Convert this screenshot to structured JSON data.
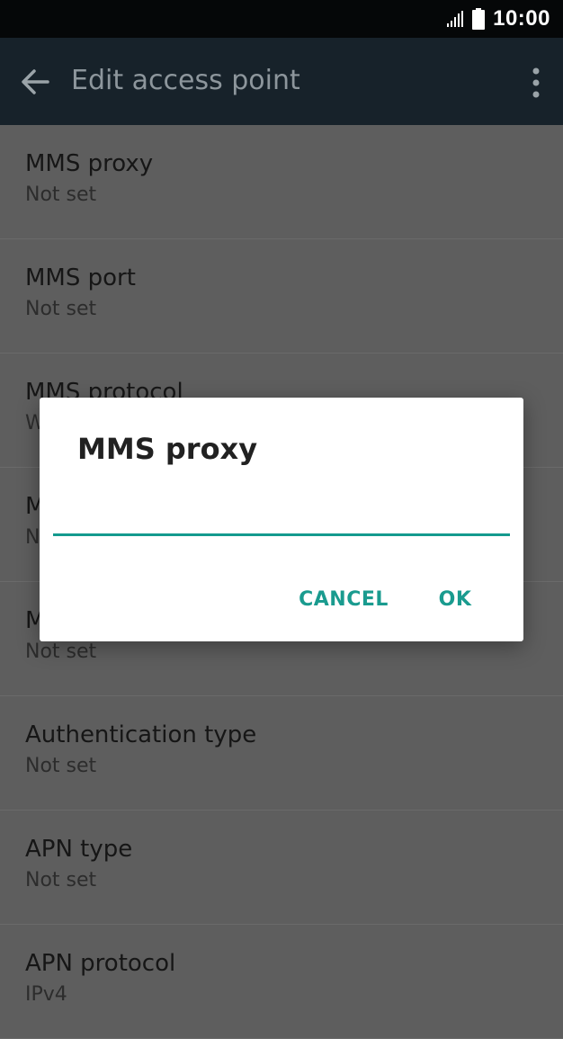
{
  "status_bar": {
    "time": "10:00",
    "icons": [
      "signal-icon",
      "battery-icon"
    ]
  },
  "app_bar": {
    "title": "Edit access point",
    "icons": [
      "back-arrow-icon",
      "more-vert-icon"
    ]
  },
  "list": [
    {
      "title": "MMS proxy",
      "value": "Not set"
    },
    {
      "title": "MMS port",
      "value": "Not set"
    },
    {
      "title": "MMS protocol",
      "value": "W"
    },
    {
      "title": "M",
      "value": "N"
    },
    {
      "title": "M",
      "value": "Not set"
    },
    {
      "title": "Authentication type",
      "value": "Not set"
    },
    {
      "title": "APN type",
      "value": "Not set"
    },
    {
      "title": "APN protocol",
      "value": "IPv4"
    }
  ],
  "dialog": {
    "title": "MMS proxy",
    "input_value": "",
    "cancel_label": "CANCEL",
    "ok_label": "OK"
  },
  "colors": {
    "accent": "#149a8e",
    "status_bar_bg": "#050708",
    "app_bar_bg": "#17222a",
    "scrim_bg": "#5e5e5e"
  }
}
